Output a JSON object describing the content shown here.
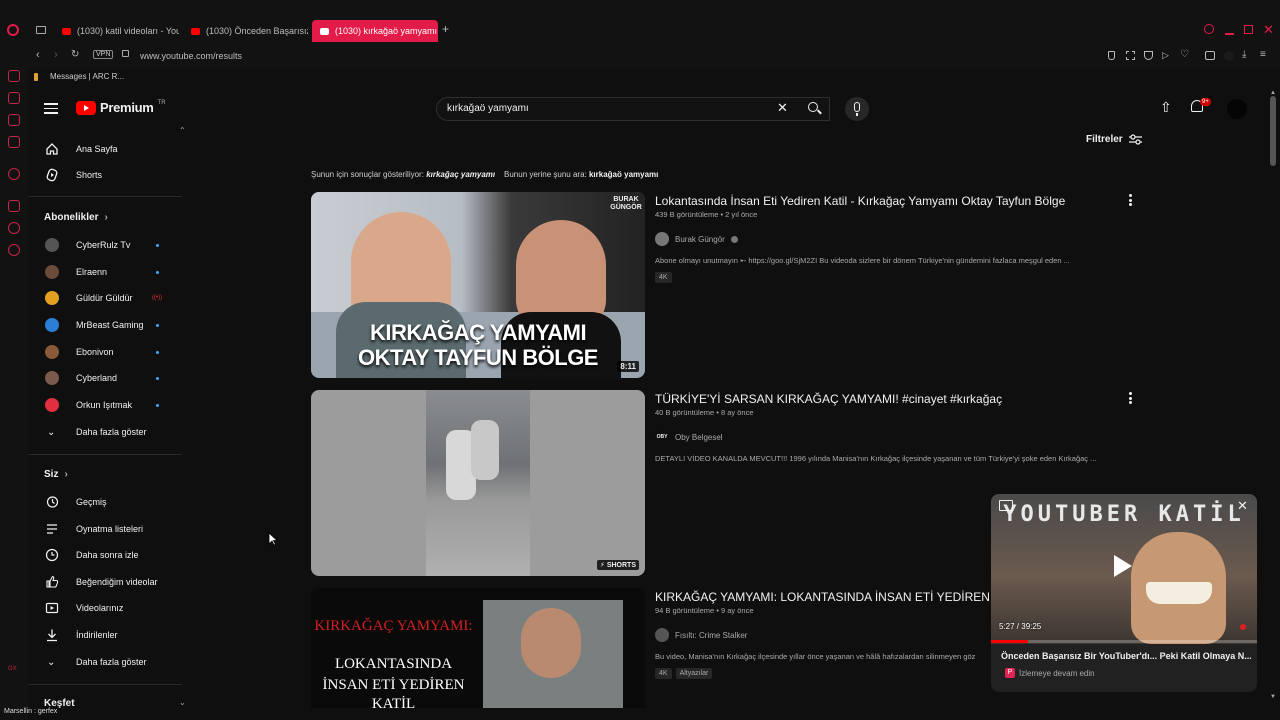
{
  "browser": {
    "tabs": [
      {
        "label": "(1030) katil videoları - You",
        "active": false
      },
      {
        "label": "(1030) Önceden Başarısız",
        "active": false
      },
      {
        "label": "(1030) kırkağaö yamyamı",
        "active": true
      }
    ],
    "url": "www.youtube.com/results",
    "vpn_label": "VPN",
    "bookmark": "Messages | ARC R...",
    "status_text": "Marsellin : gerfex"
  },
  "header": {
    "logo_text": "Premium",
    "logo_superscript": "TR",
    "search_value": "kırkağaö yamyamı",
    "notif_count": "9+"
  },
  "sidebar": {
    "main": [
      {
        "label": "Ana Sayfa",
        "icon": "home-icon"
      },
      {
        "label": "Shorts",
        "icon": "shorts-icon"
      }
    ],
    "subs_heading": "Abonelikler",
    "subs": [
      {
        "label": "CyberRulz Tv",
        "color": "#555555"
      },
      {
        "label": "Elraenn",
        "color": "#6b4a3a"
      },
      {
        "label": "Güldür Güldür",
        "color": "#e0a020"
      },
      {
        "label": "MrBeast Gaming",
        "color": "#2a7fd4"
      },
      {
        "label": "Ebonivon",
        "color": "#8a5a3a"
      },
      {
        "label": "Cyberland",
        "color": "#7a5a4a"
      },
      {
        "label": "Orkun Işıtmak",
        "color": "#e03040"
      }
    ],
    "more_subs": "Daha fazla göster",
    "you_heading": "Siz",
    "you": [
      {
        "label": "Geçmiş",
        "icon": "history-icon"
      },
      {
        "label": "Oynatma listeleri",
        "icon": "playlists-icon"
      },
      {
        "label": "Daha sonra izle",
        "icon": "clock-icon"
      },
      {
        "label": "Beğendiğim videolar",
        "icon": "like-icon"
      },
      {
        "label": "Videolarınız",
        "icon": "your-videos-icon"
      },
      {
        "label": "İndirilenler",
        "icon": "download-icon"
      }
    ],
    "more_you": "Daha fazla göster",
    "explore_heading": "Keşfet"
  },
  "results": {
    "filters_label": "Filtreler",
    "correction_prefix": "Şunun için sonuçlar gösteriliyor:",
    "correction_term": "kırkağaç yamyamı",
    "correction_alt_prefix": "Bunun yerine şunu ara:",
    "correction_alt_term": "kırkağaö yamyamı",
    "items": [
      {
        "title": "Lokantasında İnsan Eti Yediren Katil - Kırkağaç Yamyamı Oktay Tayfun Bölge",
        "meta": "439 B görüntüleme • 2 yıl önce",
        "channel": "Burak Güngör",
        "verified": true,
        "desc": "Abone olmayı unutmayın ➸ https://goo.gl/SjM2ZI Bu videoda sizlere bir dönem Türkiye'nin gündemini fazlaca meşgul eden ...",
        "badges": [
          "4K"
        ],
        "duration": "8:11",
        "thumb_text_1": "KIRKAĞAÇ YAMYAMI",
        "thumb_text_2": "OKTAY TAYFUN BÖLGE",
        "thumb_brand": "BURAK GÜNGÖR"
      },
      {
        "title": "TÜRKİYE'Yİ SARSAN KIRKAĞAÇ YAMYAMI! #cinayet #kırkağaç",
        "meta": "40 B görüntüleme • 8 ay önce",
        "channel": "Oby Belgesel",
        "channel_short": "OBY",
        "verified": false,
        "desc": "DETAYLI VİDEO KANALDA MEVCUT!!! 1996 yılında Manisa'nın Kırkağaç ilçesinde yaşanan ve tüm Türkiye'yi şoke eden Kırkağaç ...",
        "badges": [],
        "duration": "SHORTS"
      },
      {
        "title": "KIRKAĞAÇ YAMYAMI: LOKANTASINDA İNSAN ETİ YEDİREN KA",
        "meta": "94 B görüntüleme • 9 ay önce",
        "channel": "Fısıltı: Crime Stalker",
        "verified": false,
        "desc": "Bu video, Manisa'nın Kırkağaç ilçesinde yıllar önce yaşanan ve hâlâ hafızalardan silinmeyen göz",
        "badges": [
          "4K",
          "Altyazılar"
        ],
        "thumb_text_1": "KIRKAĞAÇ YAMYAMI:",
        "thumb_text_2": "LOKANTASINDA",
        "thumb_text_3": "İNSAN ETİ YEDİREN",
        "thumb_text_4": "KATİL"
      }
    ]
  },
  "miniplayer": {
    "overlay_text": "YOUTUBER KATİL",
    "time": "5:27 / 39:25",
    "title": "Önceden Başarısız Bir YouTuber'dı... Peki Katil Olmaya N...",
    "continue_label": "İzlemeye devam edin",
    "progress": 0.139,
    "playlist_initial": "P"
  }
}
